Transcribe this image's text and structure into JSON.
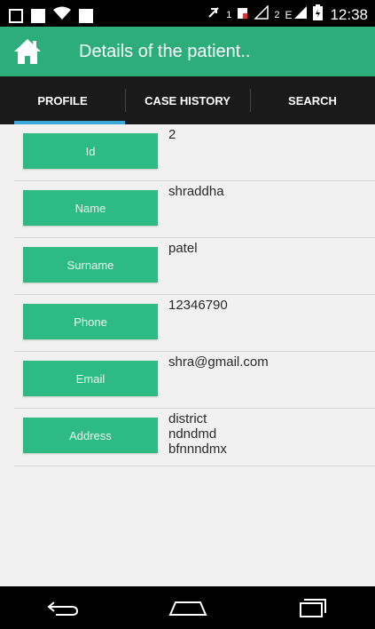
{
  "status_bar": {
    "sim_indicator": "1",
    "sim2_indicator": "2",
    "network": "E",
    "time": "12:38"
  },
  "app_bar": {
    "title": "Details of the patient.."
  },
  "tabs": [
    {
      "label": "PROFILE",
      "active": true
    },
    {
      "label": "CASE HISTORY",
      "active": false
    },
    {
      "label": "SEARCH",
      "active": false
    }
  ],
  "fields": [
    {
      "label": "Id",
      "value": "2"
    },
    {
      "label": "Name",
      "value": "shraddha"
    },
    {
      "label": "Surname",
      "value": "patel"
    },
    {
      "label": "Phone",
      "value": "12346790"
    },
    {
      "label": "Email",
      "value": "shra@gmail.com"
    },
    {
      "label": "Address",
      "lines": [
        "district",
        "ndndmd",
        "bfnnndmx"
      ]
    }
  ],
  "colors": {
    "accent": "#2dac7c",
    "button": "#2dba84",
    "tab_indicator": "#3ca8d8"
  }
}
